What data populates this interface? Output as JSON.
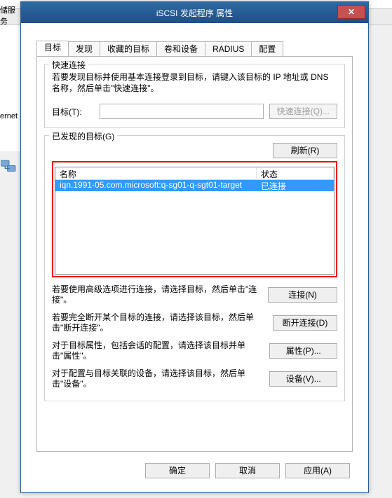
{
  "background": {
    "left_label": "储服务",
    "ernet_label": "ernet"
  },
  "window": {
    "title": "iSCSI 发起程序 属性",
    "close": "✕"
  },
  "tabs": {
    "items": [
      {
        "label": "目标"
      },
      {
        "label": "发现"
      },
      {
        "label": "收藏的目标"
      },
      {
        "label": "卷和设备"
      },
      {
        "label": "RADIUS"
      },
      {
        "label": "配置"
      }
    ],
    "active_index": 0
  },
  "quick_connect": {
    "legend": "快速连接",
    "desc": "若要发现目标并使用基本连接登录到目标，请键入该目标的 IP 地址或 DNS 名称，然后单击\"快速连接\"。",
    "target_label": "目标(T):",
    "target_value": "",
    "button": "快速连接(Q)..."
  },
  "discovered": {
    "legend": "已发现的目标(G)",
    "refresh": "刷新(R)",
    "columns": {
      "name": "名称",
      "state": "状态"
    },
    "rows": [
      {
        "name": "iqn.1991-05.com.microsoft:q-sg01-q-sgt01-target",
        "state": "已连接",
        "selected": true
      }
    ]
  },
  "actions": {
    "connect": {
      "text": "若要使用高级选项进行连接，请选择目标，然后单击\"连接\"。",
      "button": "连接(N)"
    },
    "disconnect": {
      "text": "若要完全断开某个目标的连接，请选择该目标，然后单击\"断开连接\"。",
      "button": "断开连接(D)"
    },
    "props": {
      "text": "对于目标属性，包括会话的配置，请选择该目标并单击\"属性\"。",
      "button": "属性(P)..."
    },
    "devices": {
      "text": "对于配置与目标关联的设备，请选择该目标，然后单击\"设备\"。",
      "button": "设备(V)..."
    }
  },
  "footer": {
    "ok": "确定",
    "cancel": "取消",
    "apply": "应用(A)"
  }
}
